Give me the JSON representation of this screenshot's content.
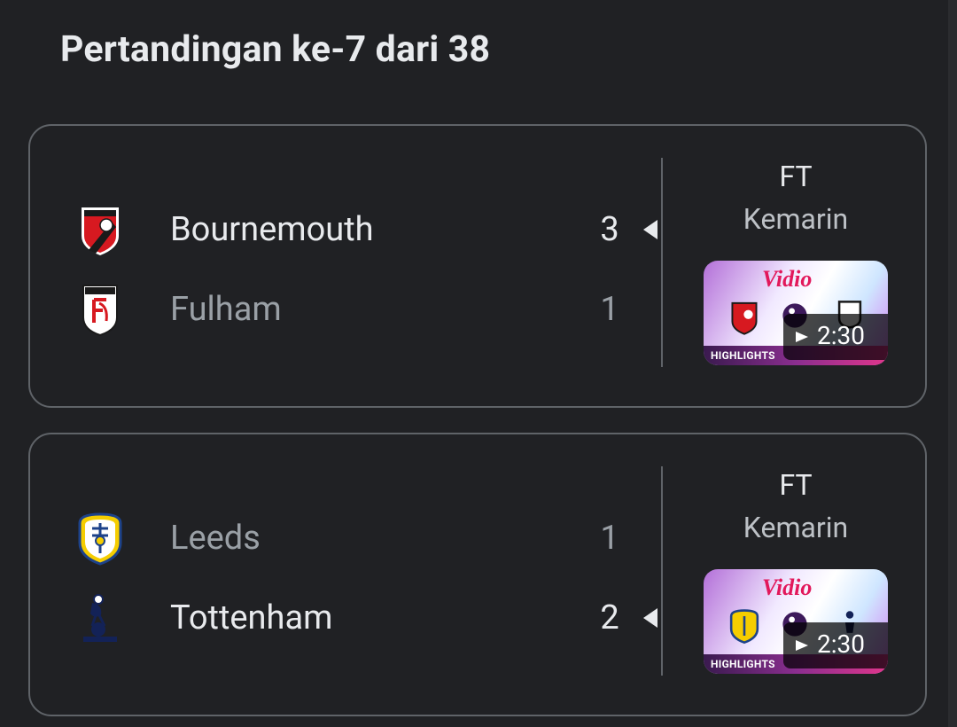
{
  "header": {
    "title": "Pertandingan ke-7 dari 38"
  },
  "matches": [
    {
      "status": "FT",
      "when": "Kemarin",
      "home": {
        "name": "Bournemouth",
        "score": "3",
        "logo": "bournemouth-crest-icon",
        "winner": true
      },
      "away": {
        "name": "Fulham",
        "score": "1",
        "logo": "fulham-crest-icon",
        "winner": false
      },
      "video": {
        "brand": "Vidio",
        "label": "HIGHLIGHTS",
        "duration": "2:30"
      }
    },
    {
      "status": "FT",
      "when": "Kemarin",
      "home": {
        "name": "Leeds",
        "score": "1",
        "logo": "leeds-crest-icon",
        "winner": false
      },
      "away": {
        "name": "Tottenham",
        "score": "2",
        "logo": "tottenham-crest-icon",
        "winner": true
      },
      "video": {
        "brand": "Vidio",
        "label": "HIGHLIGHTS",
        "duration": "2:30"
      }
    }
  ],
  "colors": {
    "background": "#202124",
    "border": "#5f6368",
    "text": "#e8eaed",
    "muted": "#9aa0a6",
    "vidio_red": "#e2185b"
  }
}
